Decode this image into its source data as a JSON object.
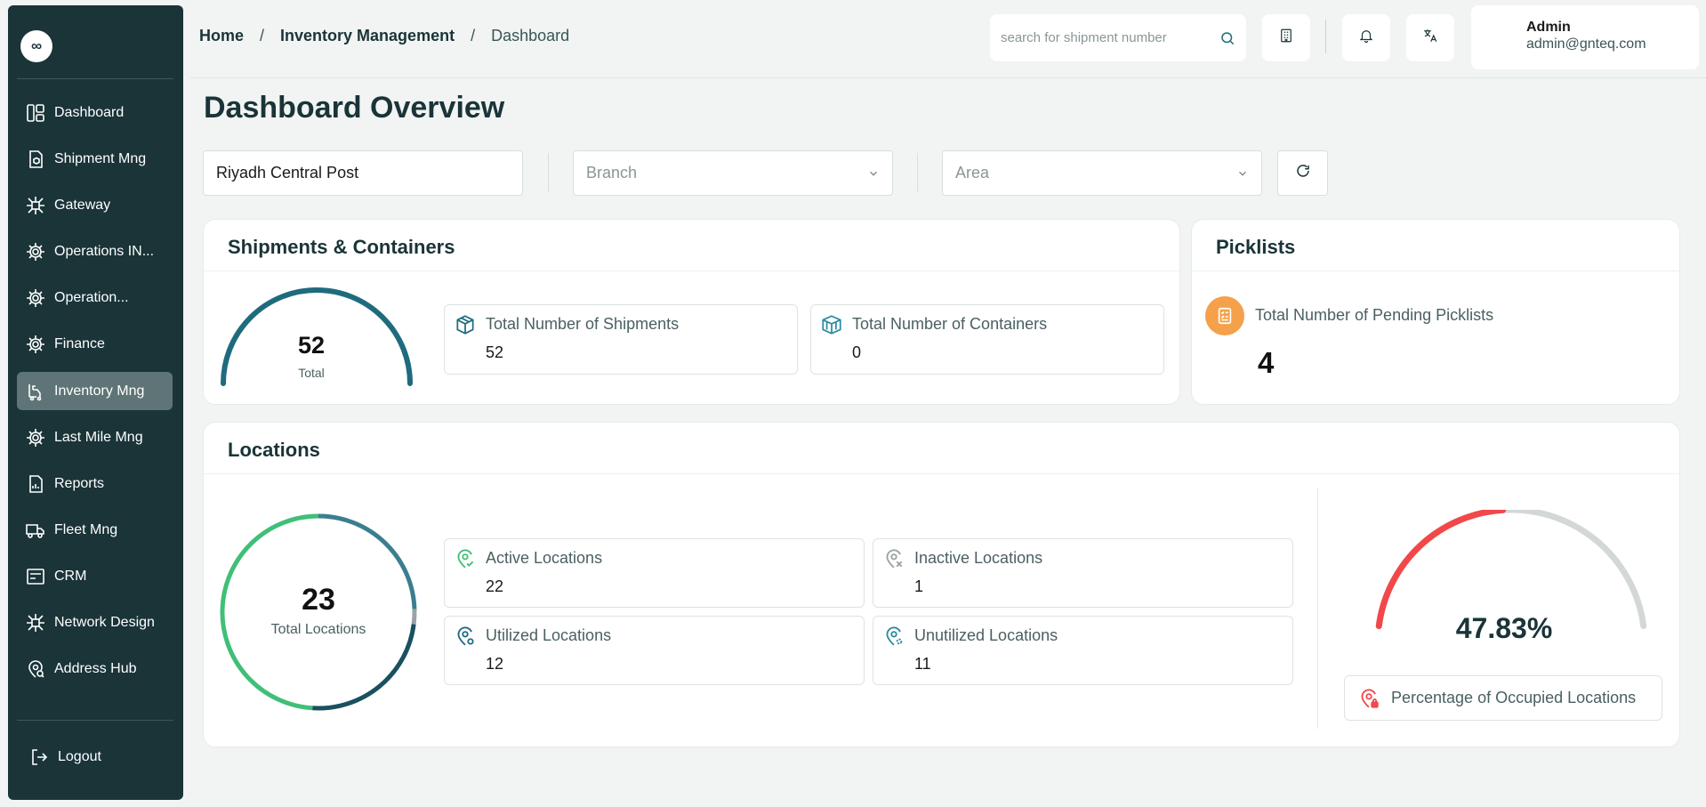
{
  "sidebar": {
    "logo": "∞",
    "items": [
      {
        "label": "Dashboard",
        "icon": "dashboard-icon",
        "active": false
      },
      {
        "label": "Shipment Mng",
        "icon": "package-doc-icon",
        "active": false
      },
      {
        "label": "Gateway",
        "icon": "network-icon",
        "active": false
      },
      {
        "label": "Operations IN...",
        "icon": "cog-network-icon",
        "active": false
      },
      {
        "label": "Operation...",
        "icon": "cog-network-icon",
        "active": false
      },
      {
        "label": "Finance",
        "icon": "cog-network-icon",
        "active": false
      },
      {
        "label": "Inventory Mng",
        "icon": "forklift-icon",
        "active": true
      },
      {
        "label": "Last Mile Mng",
        "icon": "cog-network-icon",
        "active": false
      },
      {
        "label": "Reports",
        "icon": "report-icon",
        "active": false
      },
      {
        "label": "Fleet Mng",
        "icon": "truck-icon",
        "active": false
      },
      {
        "label": "CRM",
        "icon": "crm-icon",
        "active": false
      },
      {
        "label": "Network Design",
        "icon": "network-icon",
        "active": false
      },
      {
        "label": "Address Hub",
        "icon": "location-search-icon",
        "active": false
      }
    ],
    "logout_label": "Logout"
  },
  "breadcrumb": {
    "home": "Home",
    "section": "Inventory Management",
    "current": "Dashboard",
    "separator": "/"
  },
  "search": {
    "placeholder": "search for shipment number",
    "value": ""
  },
  "user": {
    "name": "Admin",
    "email": "admin@gnteq.com"
  },
  "page_title": "Dashboard Overview",
  "filters": {
    "post_value": "Riyadh Central Post",
    "branch_placeholder": "Branch",
    "area_placeholder": "Area"
  },
  "shipments": {
    "title": "Shipments & Containers",
    "gauge_value": "52",
    "gauge_label": "Total",
    "total_shipments_label": "Total Number of Shipments",
    "total_shipments_value": "52",
    "total_containers_label": "Total Number of Containers",
    "total_containers_value": "0"
  },
  "picklists": {
    "title": "Picklists",
    "pending_label": "Total Number of Pending Picklists",
    "pending_value": "4"
  },
  "locations": {
    "title": "Locations",
    "total_value": "23",
    "total_label": "Total Locations",
    "active_label": "Active Locations",
    "active_value": "22",
    "inactive_label": "Inactive Locations",
    "inactive_value": "1",
    "utilized_label": "Utilized Locations",
    "utilized_value": "12",
    "unutilized_label": "Unutilized Locations",
    "unutilized_value": "11",
    "occupied_pct": "47.83%",
    "occupied_label": "Percentage of Occupied Locations",
    "occupied_fraction": 0.4783
  },
  "colors": {
    "sidebar_bg": "#1a3438",
    "accent_teal": "#1f6b7e",
    "active_green": "#3fbf78",
    "danger_red": "#f2484a",
    "picklist_orange": "#f5a04a"
  }
}
